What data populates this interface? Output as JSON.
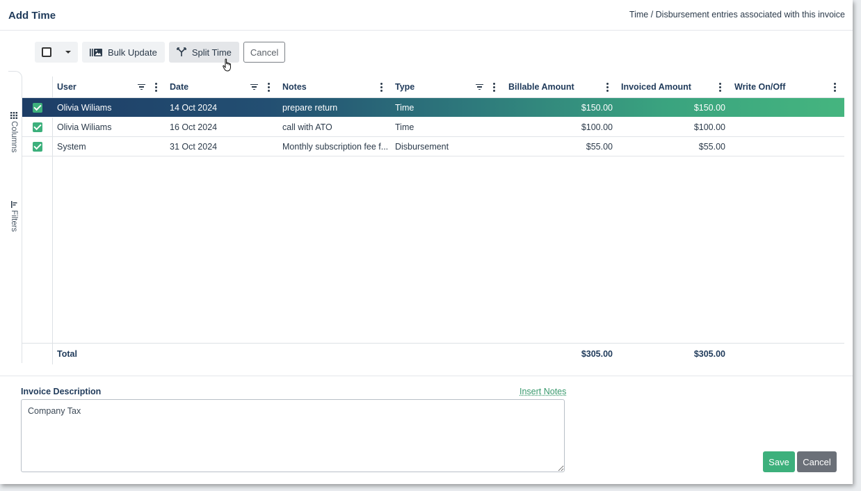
{
  "header": {
    "title": "Add Time",
    "subtitle": "Time / Disbursement entries associated with this invoice"
  },
  "toolbar": {
    "bulk_update": "Bulk Update",
    "split_time": "Split Time",
    "cancel": "Cancel"
  },
  "rail": {
    "columns": "Columns",
    "filters": "Filters"
  },
  "grid": {
    "columns": {
      "user": "User",
      "date": "Date",
      "notes": "Notes",
      "type": "Type",
      "billable": "Billable Amount",
      "invoiced": "Invoiced Amount",
      "write": "Write On/Off"
    },
    "rows": [
      {
        "user": "Olivia Wiliams",
        "date": "14 Oct 2024",
        "notes": "prepare return",
        "type": "Time",
        "billable": "$150.00",
        "invoiced": "$150.00",
        "write": ""
      },
      {
        "user": "Olivia Wiliams",
        "date": "16 Oct 2024",
        "notes": "call with ATO",
        "type": "Time",
        "billable": "$100.00",
        "invoiced": "$100.00",
        "write": ""
      },
      {
        "user": "System",
        "date": "31 Oct 2024",
        "notes": "Monthly subscription fee f...",
        "type": "Disbursement",
        "billable": "$55.00",
        "invoiced": "$55.00",
        "write": ""
      }
    ],
    "total": {
      "label": "Total",
      "billable": "$305.00",
      "invoiced": "$305.00"
    }
  },
  "invoice": {
    "label": "Invoice Description",
    "insert_notes": "Insert Notes",
    "description": "Company Tax"
  },
  "footer": {
    "save": "Save",
    "cancel": "Cancel"
  },
  "colors": {
    "accent_green": "#3db07c",
    "navy": "#1d3d66",
    "cancel_gray": "#6b7078"
  }
}
